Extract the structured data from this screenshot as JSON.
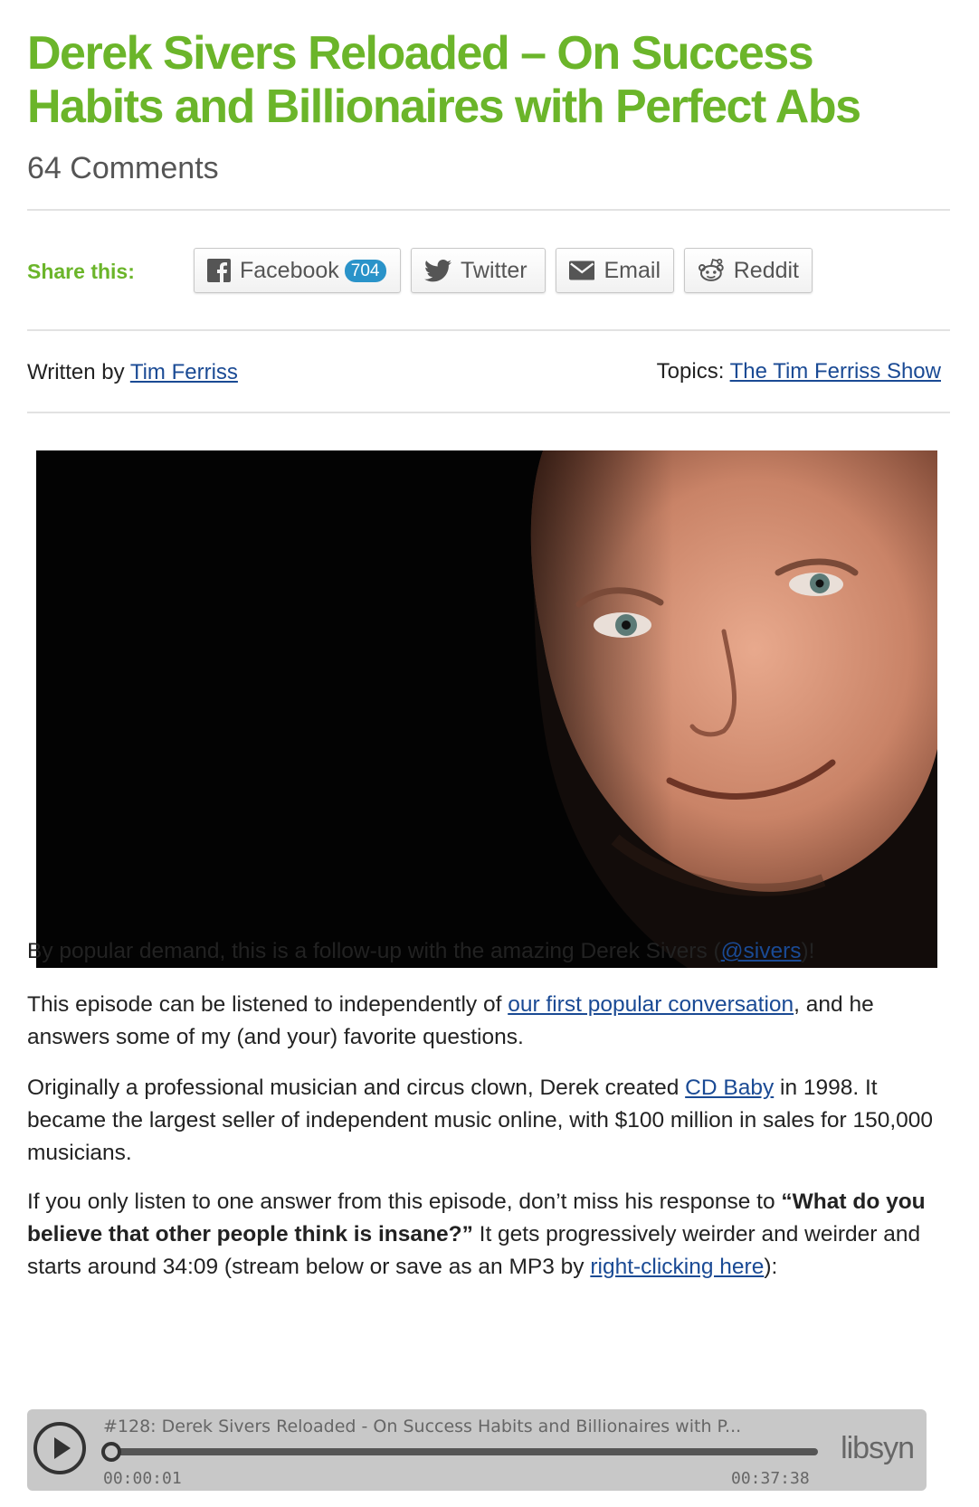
{
  "article": {
    "title": "Derek Sivers Reloaded – On Success Habits and Billionaires with Perfect Abs",
    "comments": "64 Comments"
  },
  "share": {
    "label": "Share this:",
    "buttons": [
      {
        "label": "Facebook",
        "count": "704",
        "icon": "facebook-icon"
      },
      {
        "label": "Twitter",
        "icon": "twitter-icon"
      },
      {
        "label": "Email",
        "icon": "envelope-icon"
      },
      {
        "label": "Reddit",
        "icon": "reddit-icon"
      }
    ]
  },
  "meta": {
    "written_prefix": "Written by ",
    "author": "Tim Ferriss",
    "topics_prefix": "Topics: ",
    "topic": "The Tim Ferriss Show"
  },
  "body": {
    "p1_a": "By popular demand, this is a follow-up with the amazing Derek Sivers (",
    "p1_link": "@sivers",
    "p1_b": ")!",
    "p2_a": "This episode can be listened to independently of ",
    "p2_link": "our first popular conversation",
    "p2_b": ", and he answers some of my (and your) favorite questions.",
    "p3_a": "Originally a professional musician and circus clown, Derek created ",
    "p3_link": "CD Baby",
    "p3_b": " in 1998. It became the largest seller of independent music online, with $100 million in sales for 150,000 musicians.",
    "p4_a": "If you only listen to one answer from this episode, don’t miss his response to ",
    "p4_bold": "“What do you believe that other people think is insane?”",
    "p4_b": " It gets progressively weirder and weirder and starts around 34:09 (stream below or save as an MP3 by ",
    "p4_link": "right-clicking here",
    "p4_c": "):"
  },
  "player": {
    "episode_title": "#128: Derek Sivers Reloaded - On Success Habits and Billionaires with P...",
    "elapsed": "00:00:01",
    "duration": "00:37:38",
    "brand": "libsyn"
  },
  "colors": {
    "title_green": "#6bb52a",
    "link_blue": "#1a4a94",
    "badge_blue": "#2a93c9"
  }
}
